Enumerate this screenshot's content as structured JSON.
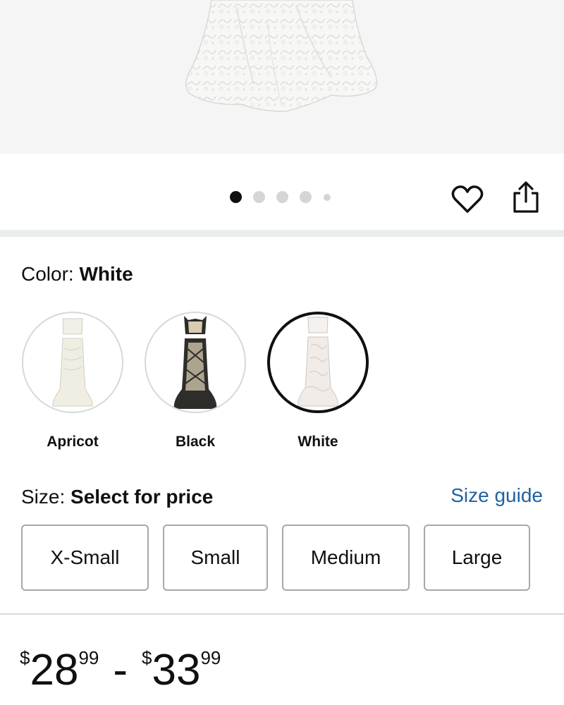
{
  "product": {
    "image_alt": "",
    "carousel": {
      "total": 5,
      "active_index": 0
    }
  },
  "actions": {
    "wishlist_icon": "heart-outline-icon",
    "share_icon": "share-icon"
  },
  "color": {
    "label": "Color: ",
    "selected": "White",
    "options": [
      {
        "name": "Apricot",
        "selected": false,
        "colors": {
          "top": "#f2f0e6",
          "skirt": "#f0eee3"
        }
      },
      {
        "name": "Black",
        "selected": false,
        "colors": {
          "top": "#2b2b28",
          "skirt": "#2f2d2a",
          "lining": "#d8ccb1"
        }
      },
      {
        "name": "White",
        "selected": true,
        "colors": {
          "top": "#f4f1ee",
          "skirt": "#f1ece8"
        }
      }
    ]
  },
  "size": {
    "label": "Size: ",
    "prompt": "Select for price",
    "guide_link": "Size guide",
    "options": [
      "X-Small",
      "Small",
      "Medium",
      "Large"
    ]
  },
  "price": {
    "low": {
      "symbol": "$",
      "whole": "28",
      "fraction": "99"
    },
    "separator": "-",
    "high": {
      "symbol": "$",
      "whole": "33",
      "fraction": "99"
    }
  },
  "colors": {
    "link": "#2162a1",
    "selected_border": "#0f1111",
    "dot_active": "#0f1111",
    "dot_inactive": "#d5d5d5"
  }
}
